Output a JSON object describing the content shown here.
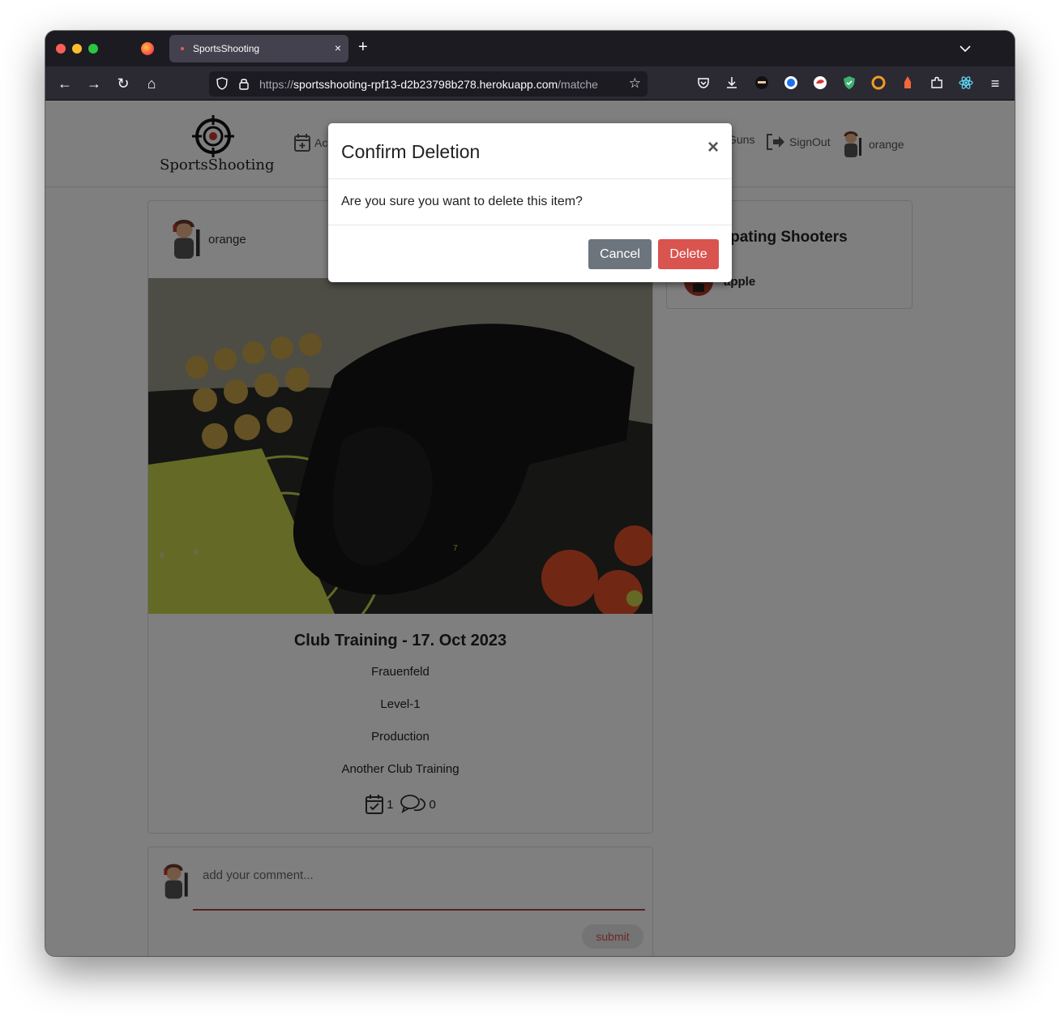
{
  "browser": {
    "tab_title": "SportsShooting",
    "tab_close": "×",
    "new_tab": "+",
    "tab_list": "⌄",
    "url_host": "https://sportsshooting-rpf13-d2b23798b278.herokuapp.com/matche",
    "url_scheme": "https://",
    "url_domain": "sportsshooting-rpf13-d2b23798b278.herokuapp.com",
    "url_path": "/matche",
    "back": "←",
    "forward": "→",
    "reload": "↻",
    "home": "⌂",
    "bookmark": "☆",
    "menu": "≡"
  },
  "site": {
    "logo_text": "SportsShooting",
    "nav": {
      "add_label": "Ac",
      "guns_label": "Guns",
      "signout_label": "SignOut",
      "profile_label": "orange"
    }
  },
  "post": {
    "author": "orange",
    "title": "Club Training - 17. Oct 2023",
    "location": "Frauenfeld",
    "level": "Level-1",
    "division": "Production",
    "description": "Another Club Training",
    "participants_count": "1",
    "comments_count": "0"
  },
  "sidebar": {
    "title": "Participating Shooters",
    "shooters": [
      {
        "name": "apple"
      }
    ]
  },
  "comment_form": {
    "placeholder": "add your comment...",
    "submit_label": "submit"
  },
  "modal": {
    "title": "Confirm Deletion",
    "close": "×",
    "body": "Are you sure you want to delete this item?",
    "cancel_label": "Cancel",
    "delete_label": "Delete"
  },
  "colors": {
    "delete": "#d9534f",
    "cancel": "#6c757d",
    "browser_chrome": "#2b2a33"
  }
}
